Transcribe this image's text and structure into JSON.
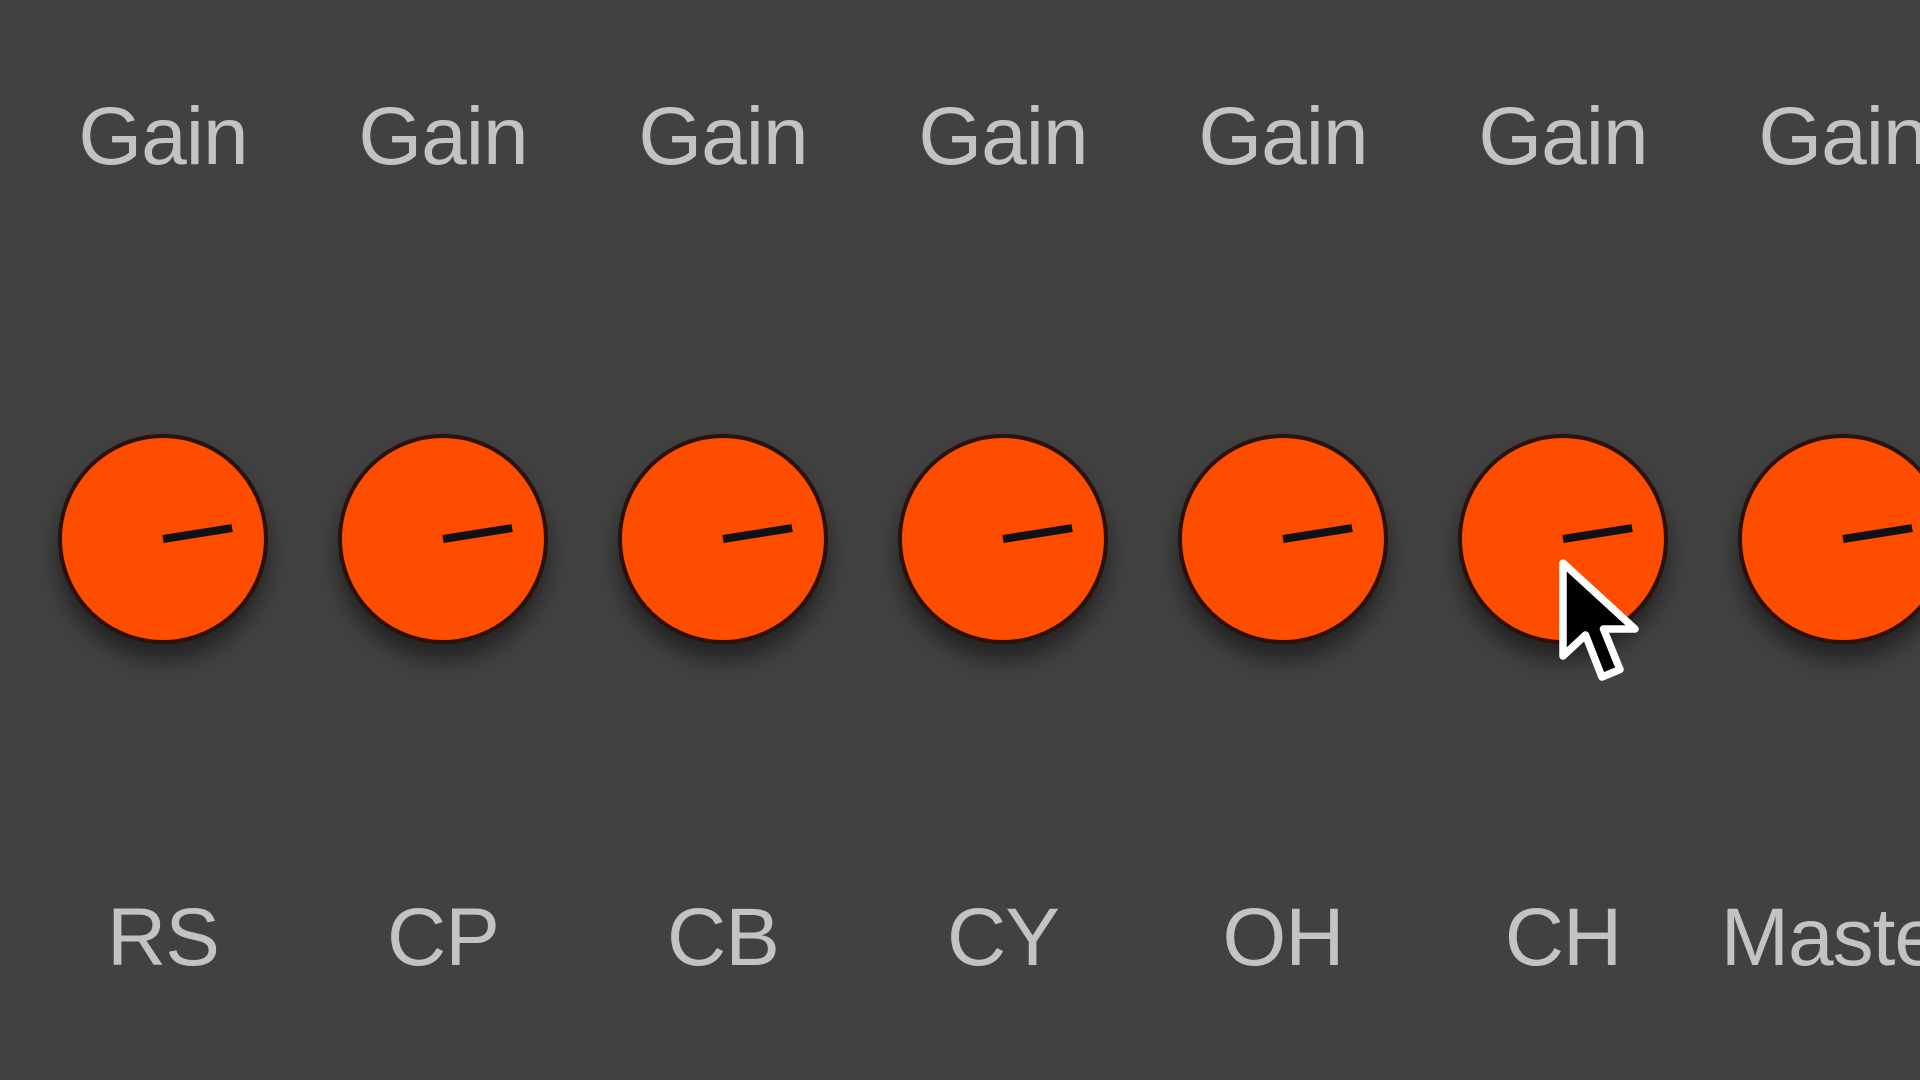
{
  "mixer": {
    "channels": [
      {
        "param_label": "Gain",
        "channel_label": "RS",
        "gain": 0.8
      },
      {
        "param_label": "Gain",
        "channel_label": "CP",
        "gain": 0.8
      },
      {
        "param_label": "Gain",
        "channel_label": "CB",
        "gain": 0.8
      },
      {
        "param_label": "Gain",
        "channel_label": "CY",
        "gain": 0.8
      },
      {
        "param_label": "Gain",
        "channel_label": "OH",
        "gain": 0.8
      },
      {
        "param_label": "Gain",
        "channel_label": "CH",
        "gain": 0.8
      },
      {
        "param_label": "Gain",
        "channel_label": "Master",
        "gain": 0.8
      }
    ]
  },
  "colors": {
    "background": "#414141",
    "knob": "#ff4d00",
    "label": "#c3c3c3"
  }
}
